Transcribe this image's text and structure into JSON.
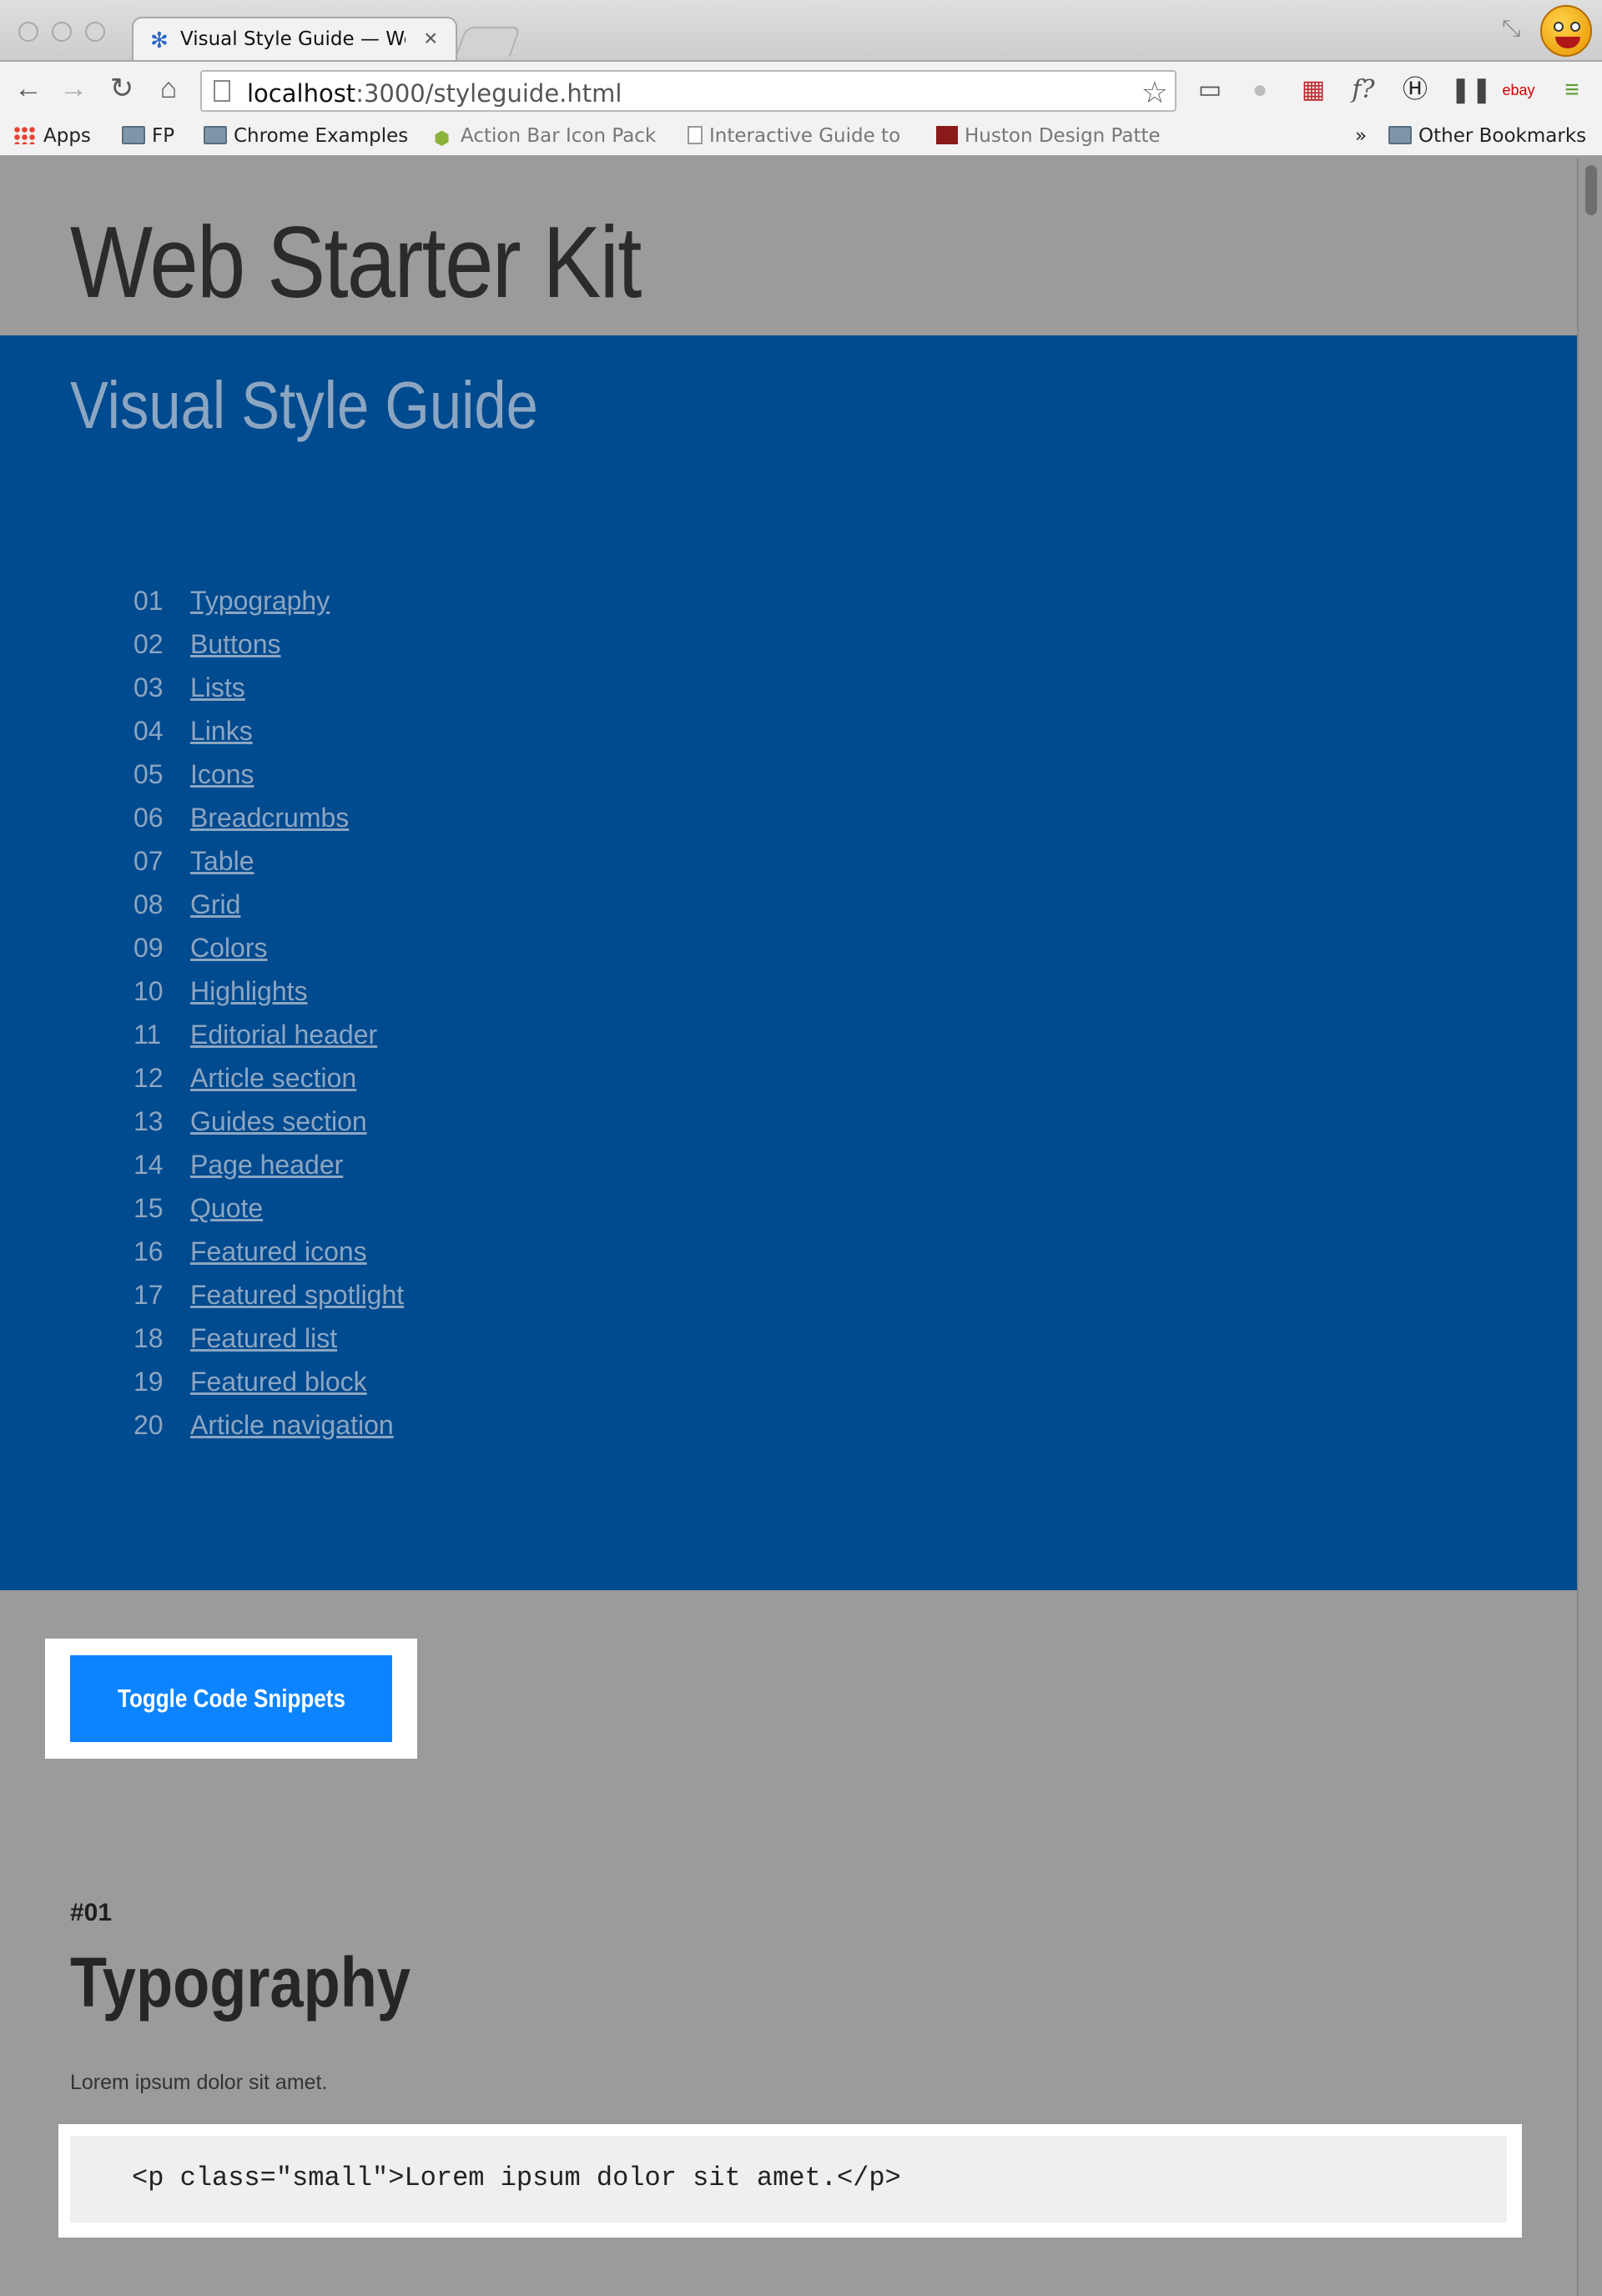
{
  "browser": {
    "tab_title": "Visual Style Guide — Web S",
    "url_host": "localhost",
    "url_path": ":3000/styleguide.html",
    "bookmarks": [
      {
        "label": "Apps",
        "icon": "apps-icon"
      },
      {
        "label": "FP",
        "icon": "folder-icon"
      },
      {
        "label": "Chrome Examples",
        "icon": "folder-icon"
      },
      {
        "label": "Action Bar Icon Pack",
        "icon": "android-icon"
      },
      {
        "label": "Interactive Guide to",
        "icon": "page-icon"
      },
      {
        "label": "Huston Design Patte",
        "icon": "site-icon"
      }
    ],
    "overflow_label": "»",
    "other_bookmarks": "Other Bookmarks"
  },
  "page": {
    "site_title": "Web Starter Kit",
    "hero_title": "Visual Style Guide",
    "toc": [
      {
        "num": "01",
        "label": "Typography"
      },
      {
        "num": "02",
        "label": "Buttons"
      },
      {
        "num": "03",
        "label": "Lists"
      },
      {
        "num": "04",
        "label": "Links"
      },
      {
        "num": "05",
        "label": "Icons"
      },
      {
        "num": "06",
        "label": "Breadcrumbs"
      },
      {
        "num": "07",
        "label": "Table"
      },
      {
        "num": "08",
        "label": "Grid"
      },
      {
        "num": "09",
        "label": "Colors"
      },
      {
        "num": "10",
        "label": "Highlights"
      },
      {
        "num": "11",
        "label": "Editorial header"
      },
      {
        "num": "12",
        "label": "Article section"
      },
      {
        "num": "13",
        "label": "Guides section"
      },
      {
        "num": "14",
        "label": "Page header"
      },
      {
        "num": "15",
        "label": "Quote"
      },
      {
        "num": "16",
        "label": "Featured icons"
      },
      {
        "num": "17",
        "label": "Featured spotlight"
      },
      {
        "num": "18",
        "label": "Featured list"
      },
      {
        "num": "19",
        "label": "Featured block"
      },
      {
        "num": "20",
        "label": "Article navigation"
      }
    ],
    "toggle_button": "Toggle Code Snippets",
    "section": {
      "number": "#01",
      "title": "Typography",
      "sample_text": "Lorem ipsum dolor sit amet.",
      "code": "<p class=\"small\">Lorem ipsum dolor sit amet.</p>"
    }
  },
  "colors": {
    "hero_bg": "#004a8f",
    "button_bg": "#0c84ff",
    "overlay_gray": "#9b9b9b"
  }
}
